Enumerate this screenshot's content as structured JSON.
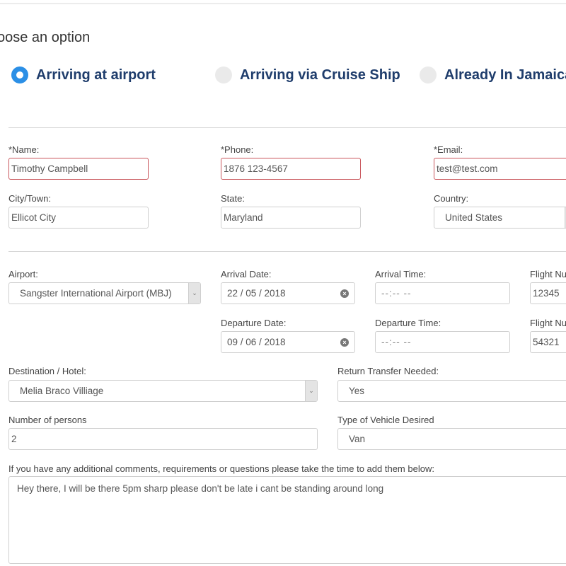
{
  "section_title": "oose an option",
  "options": [
    {
      "label": "Arriving at airport",
      "checked": true
    },
    {
      "label": "Arriving via Cruise Ship",
      "checked": false
    },
    {
      "label": "Already In Jamaica",
      "checked": false
    }
  ],
  "contact": {
    "name": {
      "label": "*Name:",
      "value": "Timothy Campbell"
    },
    "phone": {
      "label": "*Phone:",
      "value": "1876 123-4567"
    },
    "email": {
      "label": "*Email:",
      "value": "test@test.com"
    },
    "city": {
      "label": "City/Town:",
      "value": "Ellicot City"
    },
    "state": {
      "label": "State:",
      "value": "Maryland"
    },
    "country": {
      "label": "Country:",
      "value": "United States"
    }
  },
  "travel": {
    "airport": {
      "label": "Airport:",
      "value": "Sangster International Airport (MBJ)"
    },
    "arrival_date": {
      "label": "Arrival Date:",
      "value": "22 / 05 / 2018"
    },
    "arrival_time": {
      "label": "Arrival Time:",
      "value": "--:-- --"
    },
    "arrival_flight": {
      "label": "Flight Nu",
      "value": "12345"
    },
    "departure_date": {
      "label": "Departure Date:",
      "value": "09 / 06 / 2018"
    },
    "departure_time": {
      "label": "Departure Time:",
      "value": "--:-- --"
    },
    "departure_flight": {
      "label": "Flight Nu",
      "value": "54321"
    }
  },
  "booking": {
    "destination": {
      "label": "Destination / Hotel:",
      "value": "Melia Braco Villiage"
    },
    "return_transfer": {
      "label": "Return Transfer Needed:",
      "value": "Yes"
    },
    "persons": {
      "label": "Number of persons",
      "value": "2"
    },
    "vehicle": {
      "label": "Type of Vehicle Desired",
      "value": "Van"
    }
  },
  "comments": {
    "label": "If you have any additional comments, requirements or questions please take the time to add them below:",
    "value": "Hey there, I will be there 5pm sharp please don't be late i cant be standing around long"
  },
  "icons": {
    "select_arrow": "⌄",
    "clear": "×"
  },
  "colors": {
    "accent": "#2b8fe6",
    "option_text": "#1f3d6c",
    "error_border": "#c9555b"
  }
}
